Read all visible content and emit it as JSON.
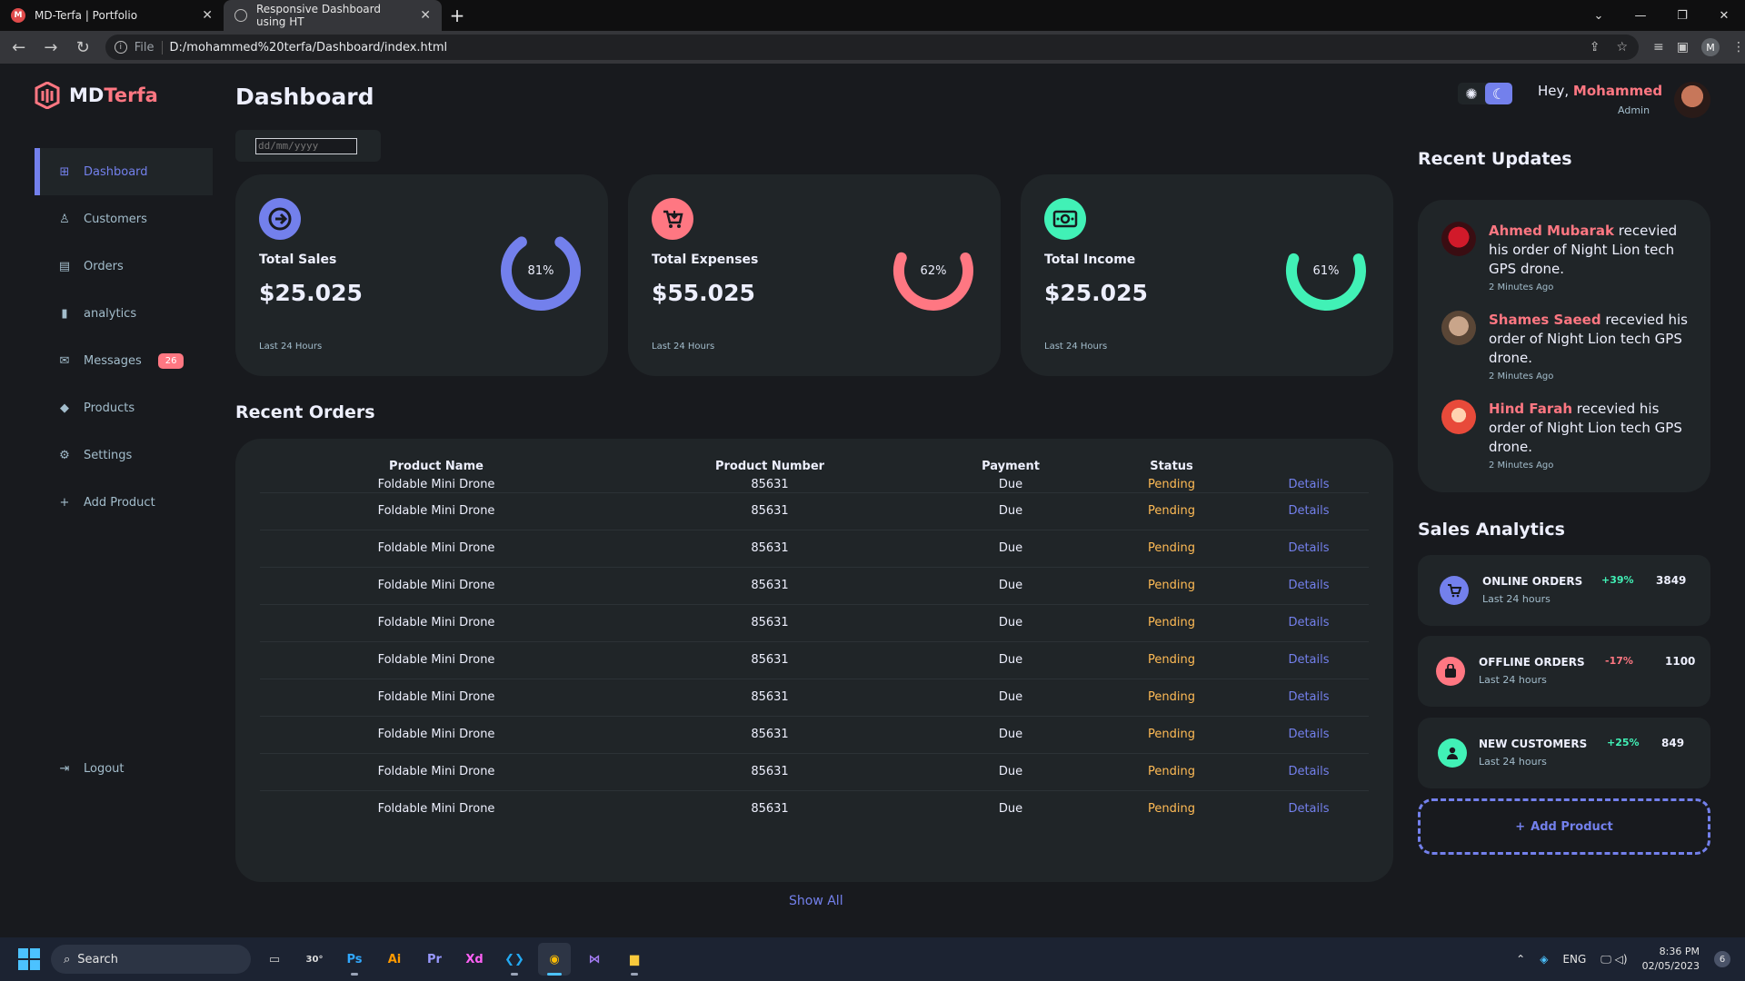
{
  "browser": {
    "tabs": [
      {
        "title": "MD-Terfa | Portfolio",
        "active": false
      },
      {
        "title": "Responsive Dashboard using HT",
        "active": true
      }
    ],
    "scheme": "File",
    "url": "D:/mohammed%20terfa/Dashboard/index.html"
  },
  "app": {
    "logo": {
      "part1": "MD",
      "part2": "Terfa"
    },
    "sidebar": {
      "items": [
        {
          "label": "Dashboard",
          "icon": "grid-icon",
          "active": true
        },
        {
          "label": "Customers",
          "icon": "person-icon"
        },
        {
          "label": "Orders",
          "icon": "receipt-icon"
        },
        {
          "label": "analytics",
          "icon": "bar-chart-icon"
        },
        {
          "label": "Messages",
          "icon": "mail-icon",
          "badge": "26"
        },
        {
          "label": "Products",
          "icon": "tag-icon"
        },
        {
          "label": "Settings",
          "icon": "gear-icon"
        },
        {
          "label": "Add Product",
          "icon": "plus-icon"
        }
      ],
      "logout": "Logout"
    },
    "page_title": "Dashboard",
    "date_placeholder": "dd/mm/yyyy",
    "cards": [
      {
        "label": "Total Sales",
        "value": "$25.025",
        "note": "Last 24 Hours",
        "percent": 81,
        "percent_label": "81%",
        "icon": "analytics-icon",
        "color": "#7380ec"
      },
      {
        "label": "Total Expenses",
        "value": "$55.025",
        "note": "Last 24 Hours",
        "percent": 62,
        "percent_label": "62%",
        "icon": "cart-icon",
        "color": "#ff7782"
      },
      {
        "label": "Total Income",
        "value": "$25.025",
        "note": "Last 24 Hours",
        "percent": 61,
        "percent_label": "61%",
        "icon": "money-icon",
        "color": "#41f1b6"
      }
    ],
    "recent_orders": {
      "title": "Recent Orders",
      "columns": [
        "Product Name",
        "Product Number",
        "Payment",
        "Status",
        ""
      ],
      "rows": [
        [
          "Foldable Mini Drone",
          "85631",
          "Due",
          "Pending",
          "Details"
        ],
        [
          "Foldable Mini Drone",
          "85631",
          "Due",
          "Pending",
          "Details"
        ],
        [
          "Foldable Mini Drone",
          "85631",
          "Due",
          "Pending",
          "Details"
        ],
        [
          "Foldable Mini Drone",
          "85631",
          "Due",
          "Pending",
          "Details"
        ],
        [
          "Foldable Mini Drone",
          "85631",
          "Due",
          "Pending",
          "Details"
        ],
        [
          "Foldable Mini Drone",
          "85631",
          "Due",
          "Pending",
          "Details"
        ],
        [
          "Foldable Mini Drone",
          "85631",
          "Due",
          "Pending",
          "Details"
        ],
        [
          "Foldable Mini Drone",
          "85631",
          "Due",
          "Pending",
          "Details"
        ],
        [
          "Foldable Mini Drone",
          "85631",
          "Due",
          "Pending",
          "Details"
        ],
        [
          "Foldable Mini Drone",
          "85631",
          "Due",
          "Pending",
          "Details"
        ]
      ],
      "show_all": "Show All"
    },
    "header": {
      "greeting": "Hey, ",
      "name": "Mohammed",
      "role": "Admin"
    },
    "recent_updates": {
      "title": "Recent Updates",
      "items": [
        {
          "name": "Ahmed Mubarak",
          "text": " recevied his order of Night Lion tech GPS drone.",
          "time": "2 Minutes Ago"
        },
        {
          "name": "Shames Saeed",
          "text": " recevied his order of Night Lion tech GPS drone.",
          "time": "2 Minutes Ago"
        },
        {
          "name": "Hind Farah",
          "text": " recevied his order of Night Lion tech GPS drone.",
          "time": "2 Minutes Ago"
        }
      ]
    },
    "sales_analytics": {
      "title": "Sales Analytics",
      "items": [
        {
          "title": "ONLINE ORDERS",
          "sub": "Last 24 hours",
          "pct": "+39%",
          "count": "3849",
          "icon": "cart-icon",
          "color": "#7380ec",
          "pct_color": "#41f1b6"
        },
        {
          "title": "OFFLINE ORDERS",
          "sub": "Last 24 hours",
          "pct": "-17%",
          "count": "1100",
          "icon": "bag-icon",
          "color": "#ff7782",
          "pct_color": "#ff7782"
        },
        {
          "title": "NEW CUSTOMERS",
          "sub": "Last 24 hours",
          "pct": "+25%",
          "count": "849",
          "icon": "person-icon",
          "color": "#41f1b6",
          "pct_color": "#41f1b6"
        }
      ],
      "add_product": "Add Product"
    }
  },
  "taskbar": {
    "search": "Search",
    "weather": "30°",
    "lang": "ENG",
    "time": "8:36 PM",
    "date": "02/05/2023",
    "notifications": "6"
  }
}
